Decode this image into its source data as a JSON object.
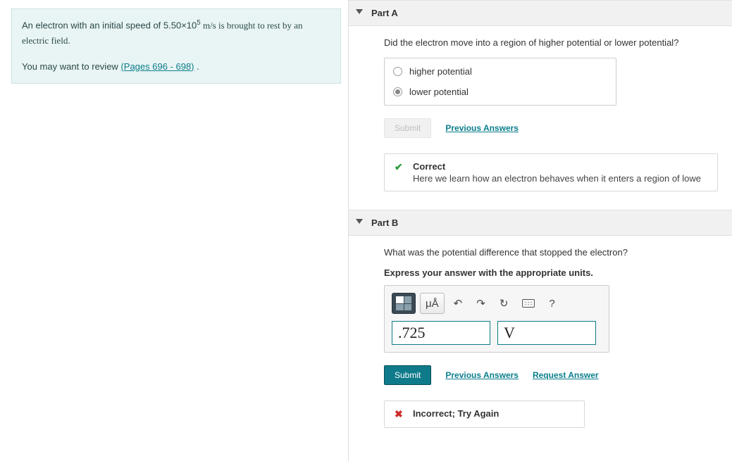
{
  "problem": {
    "text_before": "An electron with an initial speed of 5.50×10",
    "exp": "5",
    "text_after": " m/s is brought to rest by an electric field.",
    "review_prefix": "You may want to review ",
    "review_link": "(Pages 696 - 698)",
    "review_suffix": " ."
  },
  "partA": {
    "title": "Part A",
    "question": "Did the electron move into a region of higher potential or lower potential?",
    "options": {
      "o1": "higher potential",
      "o2": "lower potential"
    },
    "submit_label": "Submit",
    "prev_label": "Previous Answers",
    "feedback_title": "Correct",
    "feedback_msg": "Here we learn how an electron behaves when it enters a region of lowe"
  },
  "partB": {
    "title": "Part B",
    "question": "What was the potential difference that stopped the electron?",
    "hint": "Express your answer with the appropriate units.",
    "toolbar": {
      "units_label": "μÅ",
      "undo": "↶",
      "redo": "↷",
      "reset": "↻",
      "help": "?"
    },
    "value": ".725",
    "unit": "V",
    "submit_label": "Submit",
    "prev_label": "Previous Answers",
    "request_label": "Request Answer",
    "feedback_title": "Incorrect; Try Again"
  }
}
